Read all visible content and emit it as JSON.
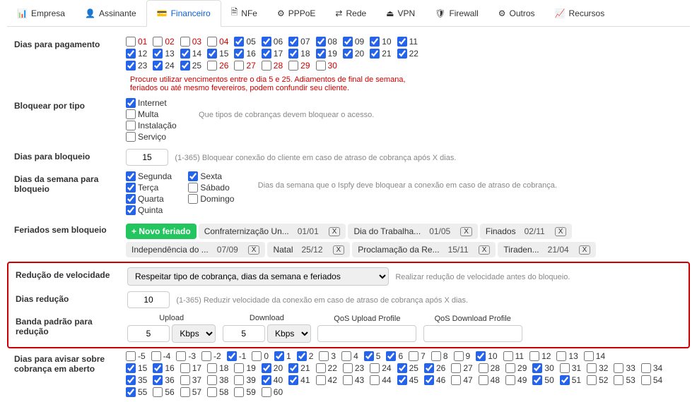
{
  "tabs": [
    {
      "label": "Empresa",
      "icon": "📊"
    },
    {
      "label": "Assinante",
      "icon": "👤"
    },
    {
      "label": "Financeiro",
      "icon": "💳",
      "active": true
    },
    {
      "label": "NFe",
      "icon": "🗎"
    },
    {
      "label": "PPPoE",
      "icon": "⚙"
    },
    {
      "label": "Rede",
      "icon": "⇄"
    },
    {
      "label": "VPN",
      "icon": "⏏"
    },
    {
      "label": "Firewall",
      "icon": "🛡"
    },
    {
      "label": "Outros",
      "icon": "⚙"
    },
    {
      "label": "Recursos",
      "icon": "📈"
    }
  ],
  "labels": {
    "dias_pagamento": "Dias para pagamento",
    "bloquear_tipo": "Bloquear por tipo",
    "dias_bloqueio": "Dias para bloqueio",
    "dias_semana": "Dias da semana para bloqueio",
    "feriados": "Feriados sem bloqueio",
    "reducao": "Redução de velocidade",
    "dias_reducao": "Dias redução",
    "banda": "Banda padrão para redução",
    "dias_avisar": "Dias para avisar sobre cobrança em aberto"
  },
  "help": {
    "pagamento": "Procure utilizar vencimentos entre o dia 5 e 25. Adiamentos de final de semana, feriados ou até mesmo fevereiros, podem confundir seu cliente.",
    "bloquear_tipo": "Que tipos de cobranças devem bloquear o acesso.",
    "dias_bloqueio": "(1-365) Bloquear conexão do cliente em caso de atraso de cobrança após X dias.",
    "dias_semana": "Dias da semana que o Ispfy deve bloquear a conexão em caso de atraso de cobrança.",
    "reducao": "Realizar redução de velocidade antes do bloqueio.",
    "dias_reducao": "(1-365) Reduzir velocidade da conexão em caso de atraso de cobrança após X dias."
  },
  "dias_pagamento": [
    {
      "n": "01",
      "c": false,
      "r": true
    },
    {
      "n": "02",
      "c": false,
      "r": true
    },
    {
      "n": "03",
      "c": false,
      "r": true
    },
    {
      "n": "04",
      "c": false,
      "r": true
    },
    {
      "n": "05",
      "c": true
    },
    {
      "n": "06",
      "c": true
    },
    {
      "n": "07",
      "c": true
    },
    {
      "n": "08",
      "c": true
    },
    {
      "n": "09",
      "c": true
    },
    {
      "n": "10",
      "c": true
    },
    {
      "n": "11",
      "c": true
    },
    {
      "n": "12",
      "c": true
    },
    {
      "n": "13",
      "c": true
    },
    {
      "n": "14",
      "c": true
    },
    {
      "n": "15",
      "c": true
    },
    {
      "n": "16",
      "c": true
    },
    {
      "n": "17",
      "c": true
    },
    {
      "n": "18",
      "c": true
    },
    {
      "n": "19",
      "c": true
    },
    {
      "n": "20",
      "c": true
    },
    {
      "n": "21",
      "c": true
    },
    {
      "n": "22",
      "c": true
    },
    {
      "n": "23",
      "c": true
    },
    {
      "n": "24",
      "c": true
    },
    {
      "n": "25",
      "c": true
    },
    {
      "n": "26",
      "c": false,
      "r": true
    },
    {
      "n": "27",
      "c": false,
      "r": true
    },
    {
      "n": "28",
      "c": false,
      "r": true
    },
    {
      "n": "29",
      "c": false,
      "r": true
    },
    {
      "n": "30",
      "c": false,
      "r": true
    }
  ],
  "bloquear_tipo": [
    {
      "label": "Internet",
      "c": true
    },
    {
      "label": "Multa",
      "c": false
    },
    {
      "label": "Instalação",
      "c": false
    },
    {
      "label": "Serviço",
      "c": false
    }
  ],
  "dias_bloqueio_val": "15",
  "dias_semana": {
    "col1": [
      {
        "label": "Segunda",
        "c": true
      },
      {
        "label": "Terça",
        "c": true
      },
      {
        "label": "Quarta",
        "c": true
      },
      {
        "label": "Quinta",
        "c": true
      }
    ],
    "col2": [
      {
        "label": "Sexta",
        "c": true
      },
      {
        "label": "Sábado",
        "c": false
      },
      {
        "label": "Domingo",
        "c": false
      }
    ]
  },
  "feriados": {
    "add": "+ Novo feriado",
    "items": [
      {
        "name": "Confraternização Un...",
        "date": "01/01"
      },
      {
        "name": "Dia do Trabalha...",
        "date": "01/05"
      },
      {
        "name": "Finados",
        "date": "02/11"
      },
      {
        "name": "Independência do ...",
        "date": "07/09"
      },
      {
        "name": "Natal",
        "date": "25/12"
      },
      {
        "name": "Proclamação da Re...",
        "date": "15/11"
      },
      {
        "name": "Tiraden...",
        "date": "21/04"
      }
    ],
    "x": "X"
  },
  "reducao_select": "Respeitar tipo de cobrança, dias da semana e feriados",
  "dias_reducao_val": "10",
  "banda": {
    "upload_label": "Upload",
    "download_label": "Download",
    "qos_up": "QoS Upload Profile",
    "qos_down": "QoS Download Profile",
    "upload_val": "5",
    "download_val": "5",
    "unit": "Kbps"
  },
  "dias_avisar": [
    {
      "n": "-5",
      "c": false
    },
    {
      "n": "-4",
      "c": false
    },
    {
      "n": "-3",
      "c": false
    },
    {
      "n": "-2",
      "c": false
    },
    {
      "n": "-1",
      "c": true
    },
    {
      "n": "0",
      "c": false
    },
    {
      "n": "1",
      "c": true
    },
    {
      "n": "2",
      "c": true
    },
    {
      "n": "3",
      "c": false
    },
    {
      "n": "4",
      "c": false
    },
    {
      "n": "5",
      "c": true
    },
    {
      "n": "6",
      "c": true
    },
    {
      "n": "7",
      "c": false
    },
    {
      "n": "8",
      "c": false
    },
    {
      "n": "9",
      "c": false
    },
    {
      "n": "10",
      "c": true
    },
    {
      "n": "11",
      "c": false
    },
    {
      "n": "12",
      "c": false
    },
    {
      "n": "13",
      "c": false
    },
    {
      "n": "14",
      "c": false
    },
    {
      "n": "15",
      "c": true
    },
    {
      "n": "16",
      "c": true
    },
    {
      "n": "17",
      "c": false
    },
    {
      "n": "18",
      "c": false
    },
    {
      "n": "19",
      "c": false
    },
    {
      "n": "20",
      "c": true
    },
    {
      "n": "21",
      "c": true
    },
    {
      "n": "22",
      "c": false
    },
    {
      "n": "23",
      "c": false
    },
    {
      "n": "24",
      "c": false
    },
    {
      "n": "25",
      "c": true
    },
    {
      "n": "26",
      "c": true
    },
    {
      "n": "27",
      "c": false
    },
    {
      "n": "28",
      "c": false
    },
    {
      "n": "29",
      "c": false
    },
    {
      "n": "30",
      "c": true
    },
    {
      "n": "31",
      "c": false
    },
    {
      "n": "32",
      "c": false
    },
    {
      "n": "33",
      "c": false
    },
    {
      "n": "34",
      "c": false
    },
    {
      "n": "35",
      "c": true
    },
    {
      "n": "36",
      "c": true
    },
    {
      "n": "37",
      "c": false
    },
    {
      "n": "38",
      "c": false
    },
    {
      "n": "39",
      "c": false
    },
    {
      "n": "40",
      "c": true
    },
    {
      "n": "41",
      "c": true
    },
    {
      "n": "42",
      "c": false
    },
    {
      "n": "43",
      "c": false
    },
    {
      "n": "44",
      "c": false
    },
    {
      "n": "45",
      "c": true
    },
    {
      "n": "46",
      "c": true
    },
    {
      "n": "47",
      "c": false
    },
    {
      "n": "48",
      "c": false
    },
    {
      "n": "49",
      "c": false
    },
    {
      "n": "50",
      "c": true
    },
    {
      "n": "51",
      "c": true
    },
    {
      "n": "52",
      "c": false
    },
    {
      "n": "53",
      "c": false
    },
    {
      "n": "54",
      "c": false
    },
    {
      "n": "55",
      "c": true
    },
    {
      "n": "56",
      "c": false
    },
    {
      "n": "57",
      "c": false
    },
    {
      "n": "58",
      "c": false
    },
    {
      "n": "59",
      "c": false
    },
    {
      "n": "60",
      "c": false
    }
  ]
}
